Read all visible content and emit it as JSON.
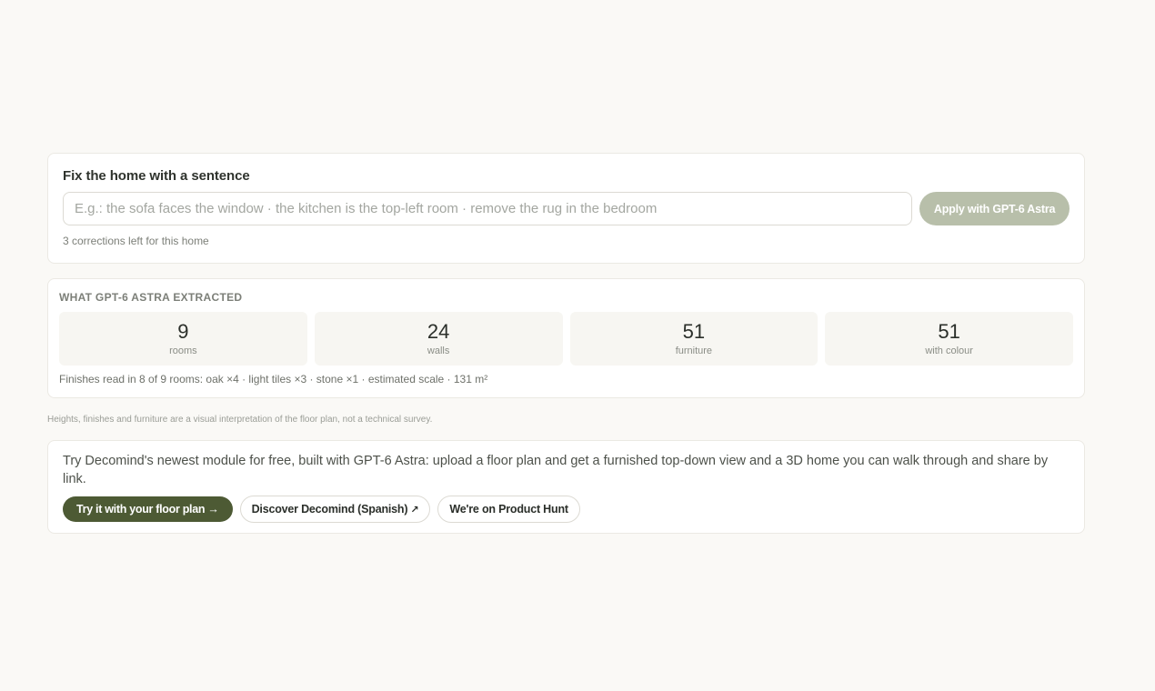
{
  "fix": {
    "title": "Fix the home with a sentence",
    "placeholder": "E.g.: the sofa faces the window · the kitchen is the top-left room · remove the rug in the bedroom",
    "value": "",
    "apply_label": "Apply with GPT-6 Astra",
    "remaining": "3 corrections left for this home"
  },
  "extracted": {
    "title": "WHAT GPT-6 ASTRA EXTRACTED",
    "stats": [
      {
        "value": "9",
        "label": "rooms"
      },
      {
        "value": "24",
        "label": "walls"
      },
      {
        "value": "51",
        "label": "furniture"
      },
      {
        "value": "51",
        "label": "with colour"
      }
    ],
    "finishes": "Finishes read in 8 of 9 rooms: oak ×4 · light tiles ×3 · stone ×1 · estimated scale · 131 m²"
  },
  "disclaimer": "Heights, finishes and furniture are a visual interpretation of the floor plan, not a technical survey.",
  "promo": {
    "text": "Try Decomind's newest module for free, built with GPT-6 Astra: upload a floor plan and get a furnished top-down view and a 3D home you can walk through and share by link.",
    "primary_label": "Try it with your floor plan →",
    "discover_label": "Discover Decomind (Spanish)",
    "discover_icon": "↗",
    "producthunt_label": "We're on Product Hunt"
  },
  "colors": {
    "background": "#faf9f6",
    "accent": "#4d5a34",
    "apply_disabled": "#b8bfaa"
  }
}
